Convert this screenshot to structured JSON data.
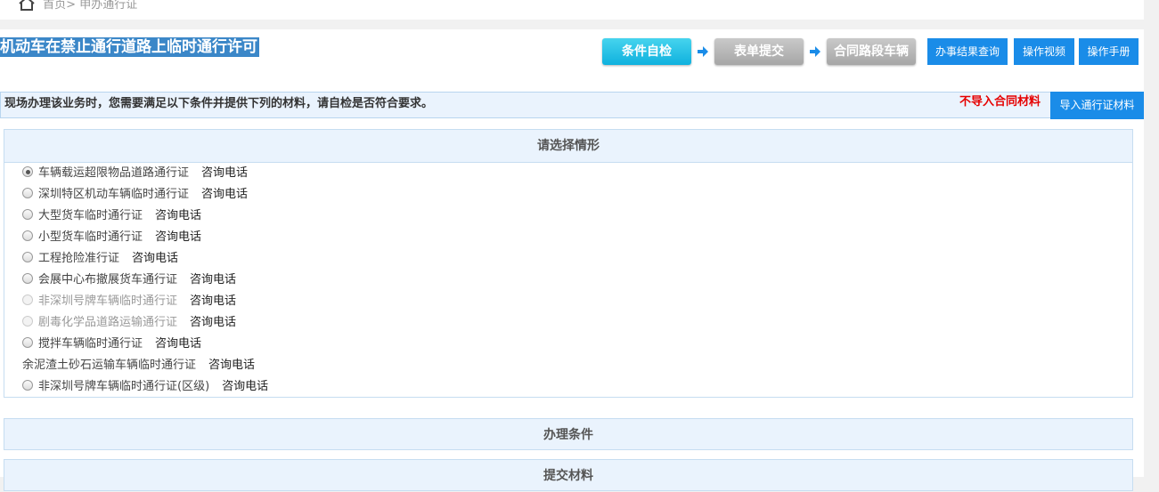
{
  "breadcrumb": {
    "home": "首页>",
    "current": "申办通行证"
  },
  "page_title": "机动车在禁止通行道路上临时通行许可",
  "steps": [
    {
      "label": "条件自检",
      "state": "active"
    },
    {
      "label": "表单提交",
      "state": "inactive"
    },
    {
      "label": "合同路段车辆",
      "state": "inactive"
    }
  ],
  "top_buttons": {
    "query": "办事结果查询",
    "video": "操作视频",
    "manual": "操作手册"
  },
  "notice": {
    "text": "现场办理该业务时，您需要满足以下条件并提供下列的材料，请自检是否符合要求。",
    "no_import": "不导入合同材料",
    "import_button": "导入通行证材料"
  },
  "situation_panel": {
    "title": "请选择情形",
    "phone_label": "咨询电话",
    "options": [
      {
        "label": "车辆载运超限物品道路通行证",
        "checked": true,
        "disabled": false
      },
      {
        "label": "深圳特区机动车辆临时通行证",
        "checked": false,
        "disabled": false
      },
      {
        "label": "大型货车临时通行证",
        "checked": false,
        "disabled": false
      },
      {
        "label": "小型货车临时通行证",
        "checked": false,
        "disabled": false
      },
      {
        "label": "工程抢险准行证",
        "checked": false,
        "disabled": false
      },
      {
        "label": "会展中心布撤展货车通行证",
        "checked": false,
        "disabled": false
      },
      {
        "label": "非深圳号牌车辆临时通行证",
        "checked": false,
        "disabled": true
      },
      {
        "label": "剧毒化学品道路运输通行证",
        "checked": false,
        "disabled": true
      },
      {
        "label": "搅拌车辆临时通行证",
        "checked": false,
        "disabled": false
      },
      {
        "label": "余泥渣土砂石运输车辆临时通行证",
        "checked": false,
        "disabled": false,
        "no_radio": true
      },
      {
        "label": "非深圳号牌车辆临时通行证(区级)",
        "checked": false,
        "disabled": false
      }
    ]
  },
  "sections": {
    "conditions": "办理条件",
    "materials": "提交材料"
  },
  "colors": {
    "accent_blue": "#1a8ce8",
    "title_bg": "#3b87c8",
    "warning_red": "#e60000",
    "panel_bg": "#eaf3fd"
  }
}
